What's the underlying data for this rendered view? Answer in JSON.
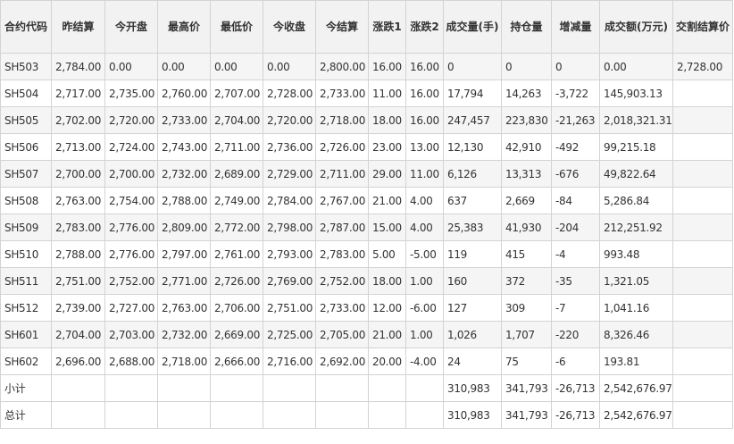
{
  "table": {
    "headers": [
      "合约代码",
      "昨结算",
      "今开盘",
      "最高价",
      "最低价",
      "今收盘",
      "今结算",
      "涨跌1",
      "涨跌2",
      "成交量(手)",
      "持仓量",
      "增减量",
      "成交额(万元)",
      "交割结算价"
    ],
    "rows": [
      [
        "SH503",
        "2,784.00",
        "0.00",
        "0.00",
        "0.00",
        "0.00",
        "2,800.00",
        "16.00",
        "16.00",
        "0",
        "0",
        "0",
        "0.00",
        "2,728.00"
      ],
      [
        "SH504",
        "2,717.00",
        "2,735.00",
        "2,760.00",
        "2,707.00",
        "2,728.00",
        "2,733.00",
        "11.00",
        "16.00",
        "17,794",
        "14,263",
        "-3,722",
        "145,903.13",
        ""
      ],
      [
        "SH505",
        "2,702.00",
        "2,720.00",
        "2,733.00",
        "2,704.00",
        "2,720.00",
        "2,718.00",
        "18.00",
        "16.00",
        "247,457",
        "223,830",
        "-21,263",
        "2,018,321.31",
        ""
      ],
      [
        "SH506",
        "2,713.00",
        "2,724.00",
        "2,743.00",
        "2,711.00",
        "2,736.00",
        "2,726.00",
        "23.00",
        "13.00",
        "12,130",
        "42,910",
        "-492",
        "99,215.18",
        ""
      ],
      [
        "SH507",
        "2,700.00",
        "2,700.00",
        "2,732.00",
        "2,689.00",
        "2,729.00",
        "2,711.00",
        "29.00",
        "11.00",
        "6,126",
        "13,313",
        "-676",
        "49,822.64",
        ""
      ],
      [
        "SH508",
        "2,763.00",
        "2,754.00",
        "2,788.00",
        "2,749.00",
        "2,784.00",
        "2,767.00",
        "21.00",
        "4.00",
        "637",
        "2,669",
        "-84",
        "5,286.84",
        ""
      ],
      [
        "SH509",
        "2,783.00",
        "2,776.00",
        "2,809.00",
        "2,772.00",
        "2,798.00",
        "2,787.00",
        "15.00",
        "4.00",
        "25,383",
        "41,930",
        "-204",
        "212,251.92",
        ""
      ],
      [
        "SH510",
        "2,788.00",
        "2,776.00",
        "2,797.00",
        "2,761.00",
        "2,793.00",
        "2,783.00",
        "5.00",
        "-5.00",
        "119",
        "415",
        "-4",
        "993.48",
        ""
      ],
      [
        "SH511",
        "2,751.00",
        "2,752.00",
        "2,771.00",
        "2,726.00",
        "2,769.00",
        "2,752.00",
        "18.00",
        "1.00",
        "160",
        "372",
        "-35",
        "1,321.05",
        ""
      ],
      [
        "SH512",
        "2,739.00",
        "2,727.00",
        "2,763.00",
        "2,706.00",
        "2,751.00",
        "2,733.00",
        "12.00",
        "-6.00",
        "127",
        "309",
        "-7",
        "1,041.16",
        ""
      ],
      [
        "SH601",
        "2,704.00",
        "2,703.00",
        "2,732.00",
        "2,669.00",
        "2,725.00",
        "2,705.00",
        "21.00",
        "1.00",
        "1,026",
        "1,707",
        "-220",
        "8,326.46",
        ""
      ],
      [
        "SH602",
        "2,696.00",
        "2,688.00",
        "2,718.00",
        "2,666.00",
        "2,716.00",
        "2,692.00",
        "20.00",
        "-4.00",
        "24",
        "75",
        "-6",
        "193.81",
        ""
      ]
    ],
    "summary_rows": [
      [
        "小计",
        "",
        "",
        "",
        "",
        "",
        "",
        "",
        "",
        "310,983",
        "341,793",
        "-26,713",
        "2,542,676.97",
        ""
      ],
      [
        "总计",
        "",
        "",
        "",
        "",
        "",
        "",
        "",
        "",
        "310,983",
        "341,793",
        "-26,713",
        "2,542,676.97",
        ""
      ]
    ]
  }
}
